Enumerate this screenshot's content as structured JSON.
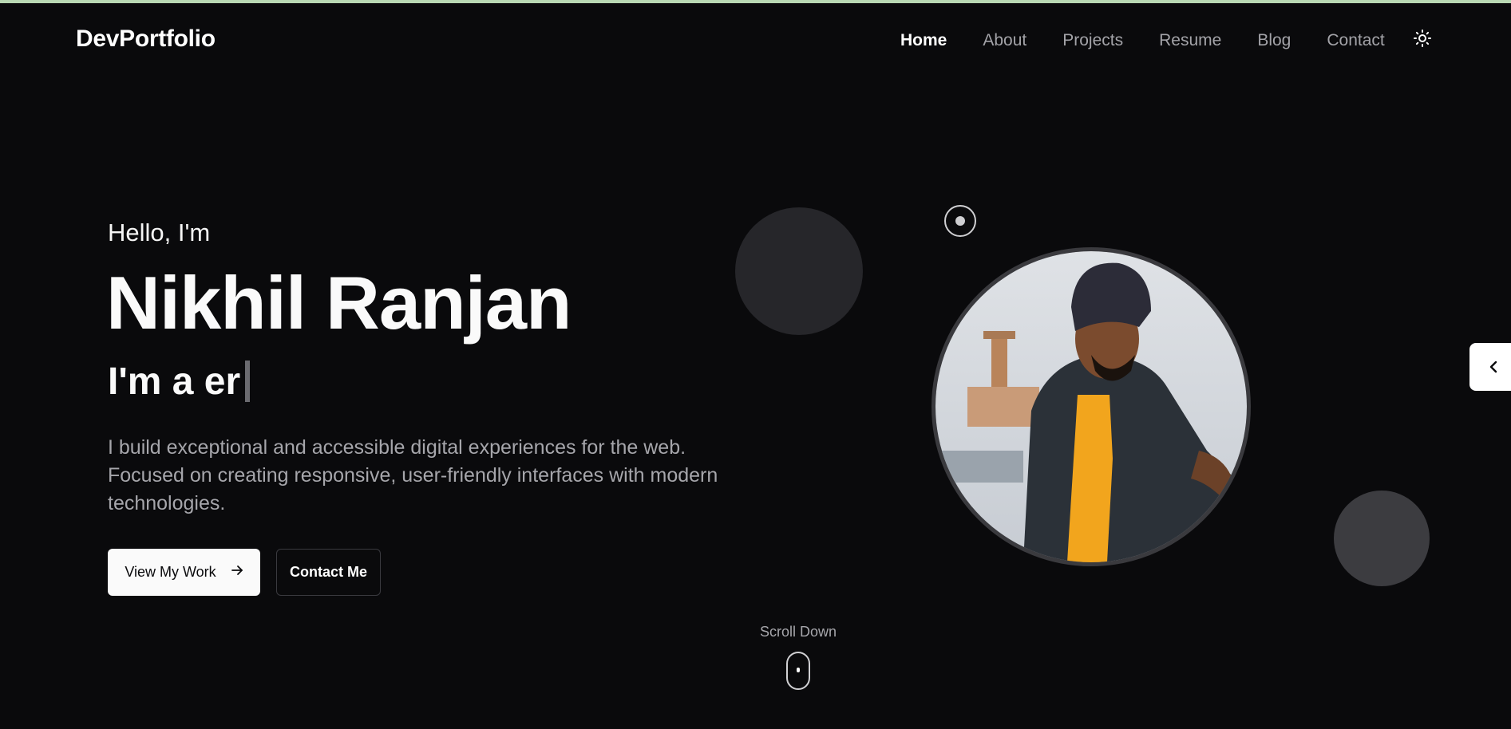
{
  "header": {
    "logo": "DevPortfolio",
    "nav": [
      {
        "label": "Home",
        "active": true
      },
      {
        "label": "About",
        "active": false
      },
      {
        "label": "Projects",
        "active": false
      },
      {
        "label": "Resume",
        "active": false
      },
      {
        "label": "Blog",
        "active": false
      },
      {
        "label": "Contact",
        "active": false
      }
    ],
    "theme_icon": "sun-icon"
  },
  "hero": {
    "greeting": "Hello, I'm",
    "name": "Nikhil Ranjan",
    "role": "I'm a er",
    "description": "I build exceptional and accessible digital experiences for the web. Focused on creating responsive, user-friendly interfaces with modern technologies.",
    "primary_button": "View My Work",
    "secondary_button": "Contact Me"
  },
  "scroll": {
    "label": "Scroll Down",
    "icon": "mouse-icon"
  },
  "side_tab": {
    "icon": "chevron-left-icon"
  },
  "colors": {
    "background": "#0a0a0c",
    "accent_bar": "#b9d8b4",
    "muted_text": "#a6a6ab"
  }
}
